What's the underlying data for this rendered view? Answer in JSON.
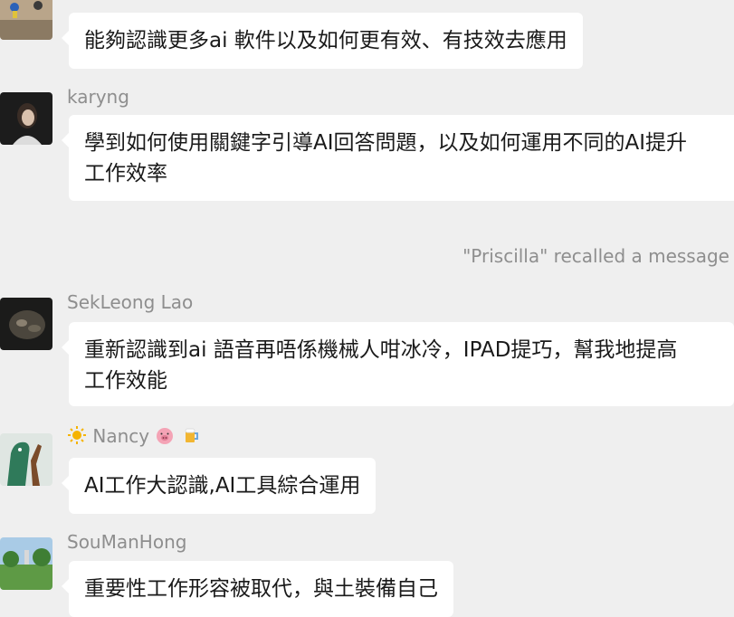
{
  "messages": [
    {
      "sender": "",
      "text": "能夠認識更多ai 軟件以及如何更有效、有技效去應用"
    },
    {
      "sender": "karyng",
      "text_line1": "學到如何使用關鍵字引導AI回答問題，以及如何運用不同的AI提升",
      "text_line2": "工作效率"
    },
    {
      "system": "\"Priscilla\" recalled a message"
    },
    {
      "sender": "SekLeong Lao",
      "text_line1": "重新認識到ai 語音再唔係機械人咁冰冷，IPAD提巧，幫我地提高",
      "text_line2": "工作效能"
    },
    {
      "sender": "Nancy",
      "sender_icons": [
        "sun-icon",
        "pig-face-icon",
        "beer-mug-icon"
      ],
      "text": "AI工作大認識,AI工具綜合運用"
    },
    {
      "sender": "SouManHong",
      "text": "重要性工作形容被取代，與土裝備自己"
    }
  ],
  "colors": {
    "background": "#efefef",
    "bubble": "#ffffff",
    "meta_text": "#8e8e8e",
    "text": "#1a1a1a"
  }
}
